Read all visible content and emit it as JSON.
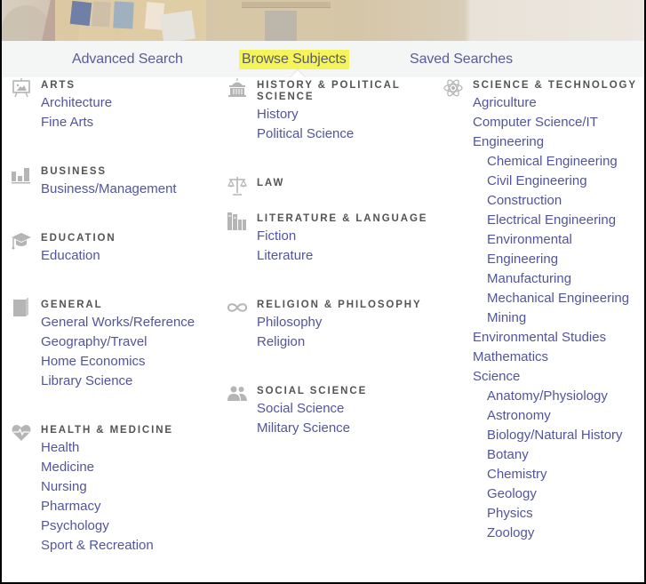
{
  "nav": {
    "items": [
      {
        "label": "Advanced Search",
        "active": false
      },
      {
        "label": "Browse Subjects",
        "active": true
      },
      {
        "label": "Saved Searches",
        "active": false
      }
    ],
    "highlight_color": "#f5f55a",
    "link_color": "#5a5c98"
  },
  "columns": [
    {
      "categories": [
        {
          "title": "ARTS",
          "icon": "easel-icon",
          "links": [
            {
              "label": "Architecture"
            },
            {
              "label": "Fine Arts"
            }
          ]
        },
        {
          "title": "BUSINESS",
          "icon": "bar-chart-icon",
          "links": [
            {
              "label": "Business/Management"
            }
          ]
        },
        {
          "title": "EDUCATION",
          "icon": "graduation-cap-icon",
          "links": [
            {
              "label": "Education"
            }
          ]
        },
        {
          "title": "GENERAL",
          "icon": "book-icon",
          "links": [
            {
              "label": "General Works/Reference"
            },
            {
              "label": "Geography/Travel"
            },
            {
              "label": "Home Economics"
            },
            {
              "label": "Library Science"
            }
          ]
        },
        {
          "title": "HEALTH & MEDICINE",
          "icon": "heart-pulse-icon",
          "links": [
            {
              "label": "Health"
            },
            {
              "label": "Medicine"
            },
            {
              "label": "Nursing"
            },
            {
              "label": "Pharmacy"
            },
            {
              "label": "Psychology"
            },
            {
              "label": "Sport & Recreation"
            }
          ]
        }
      ]
    },
    {
      "categories": [
        {
          "title": "HISTORY & POLITICAL SCIENCE",
          "icon": "capitol-building-icon",
          "links": [
            {
              "label": "History"
            },
            {
              "label": "Political Science"
            }
          ]
        },
        {
          "title": "LAW",
          "icon": "scales-icon",
          "links": []
        },
        {
          "title": "LITERATURE & LANGUAGE",
          "icon": "books-icon",
          "links": [
            {
              "label": "Fiction"
            },
            {
              "label": "Literature"
            }
          ]
        },
        {
          "title": "RELIGION & PHILOSOPHY",
          "icon": "infinity-icon",
          "links": [
            {
              "label": "Philosophy"
            },
            {
              "label": "Religion"
            }
          ]
        },
        {
          "title": "SOCIAL SCIENCE",
          "icon": "people-icon",
          "links": [
            {
              "label": "Social Science"
            },
            {
              "label": "Military Science"
            }
          ]
        }
      ]
    },
    {
      "categories": [
        {
          "title": "SCIENCE & TECHNOLOGY",
          "icon": "atom-icon",
          "links": [
            {
              "label": "Agriculture"
            },
            {
              "label": "Computer Science/IT"
            },
            {
              "label": "Engineering"
            },
            {
              "label": "Chemical Engineering",
              "sub": true
            },
            {
              "label": "Civil Engineering",
              "sub": true
            },
            {
              "label": "Construction",
              "sub": true
            },
            {
              "label": "Electrical Engineering",
              "sub": true
            },
            {
              "label": "Environmental",
              "sub": true
            },
            {
              "label": "Engineering",
              "sub": true
            },
            {
              "label": "Manufacturing",
              "sub": true
            },
            {
              "label": "Mechanical Engineering",
              "sub": true
            },
            {
              "label": "Mining",
              "sub": true
            },
            {
              "label": "Environmental Studies"
            },
            {
              "label": "Mathematics"
            },
            {
              "label": "Science"
            },
            {
              "label": "Anatomy/Physiology",
              "sub": true
            },
            {
              "label": "Astronomy",
              "sub": true
            },
            {
              "label": "Biology/Natural History",
              "sub": true
            },
            {
              "label": "Botany",
              "sub": true
            },
            {
              "label": "Chemistry",
              "sub": true
            },
            {
              "label": "Geology",
              "sub": true
            },
            {
              "label": "Physics",
              "sub": true
            },
            {
              "label": "Zoology",
              "sub": true
            }
          ]
        }
      ]
    }
  ]
}
